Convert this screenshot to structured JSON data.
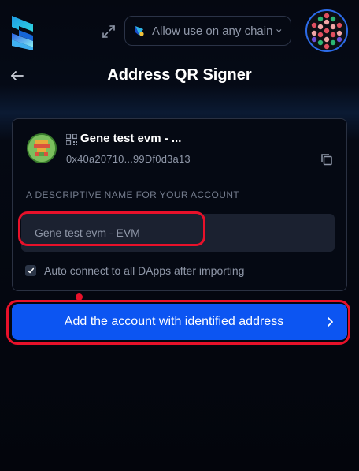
{
  "header": {
    "chain_selector_label": "Allow use on any chain",
    "page_title": "Address QR Signer"
  },
  "account": {
    "name": "Gene test evm - ...",
    "address": "0x40a20710...99Df0d3a13"
  },
  "form": {
    "name_field_label": "A DESCRIPTIVE NAME FOR YOUR ACCOUNT",
    "name_field_value": "Gene test evm - EVM",
    "auto_connect_label": "Auto connect to all DApps after importing",
    "auto_connect_checked": true
  },
  "actions": {
    "add_button_label": "Add the account with identified address"
  },
  "icons": {
    "logo": "subwallet-logo-icon",
    "expand": "expand-icon",
    "network": "network-icon",
    "chevron_down": "chevron-down-icon",
    "back": "arrow-left-icon",
    "qr": "qr-icon",
    "copy": "copy-icon",
    "checkbox": "check-icon",
    "chevron_right": "chevron-right-icon"
  },
  "colors": {
    "accent": "#0c55f2",
    "background": "#050913",
    "annotation_red": "#e8112a",
    "muted_text": "#8f97a8",
    "field_bg": "#1b2130"
  }
}
